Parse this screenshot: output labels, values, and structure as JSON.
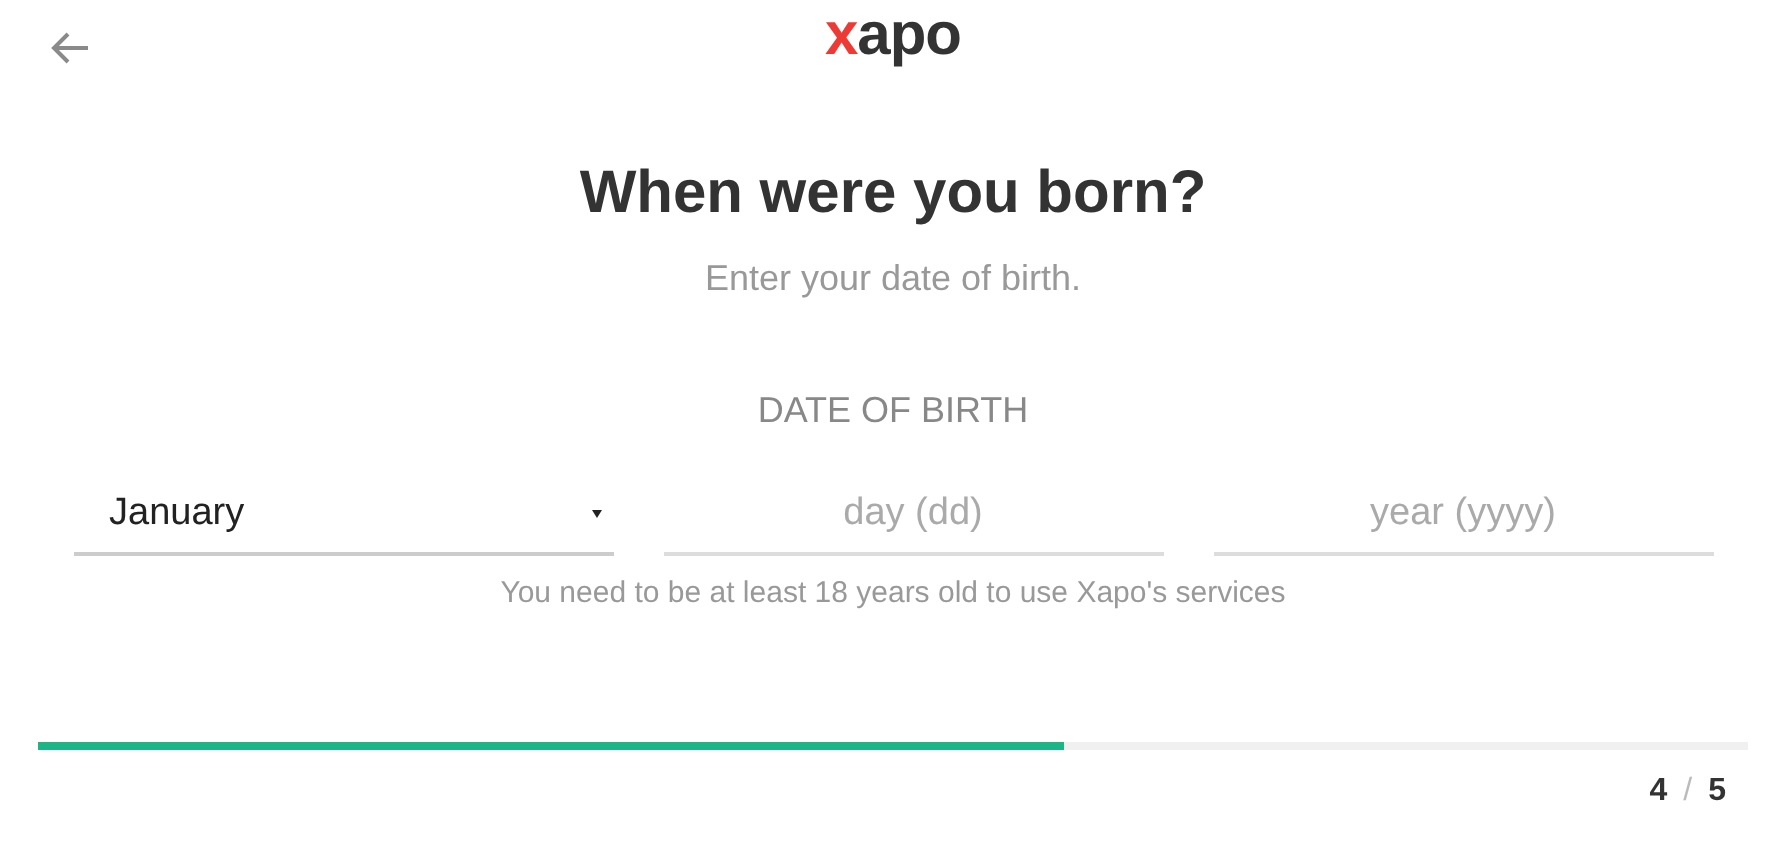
{
  "header": {
    "logo": {
      "accent": "x",
      "rest": "apo"
    }
  },
  "title": "When were you born?",
  "subtitle": "Enter your date of birth.",
  "section_label": "DATE OF BIRTH",
  "month": {
    "value": "January"
  },
  "day": {
    "placeholder": "day (dd)"
  },
  "year": {
    "placeholder": "year (yyyy)"
  },
  "hint": "You need to be at least 18 years old to use Xapo's services",
  "progress": {
    "level": 0.6
  },
  "step": {
    "current": "4",
    "separator": "/",
    "total": "5"
  }
}
